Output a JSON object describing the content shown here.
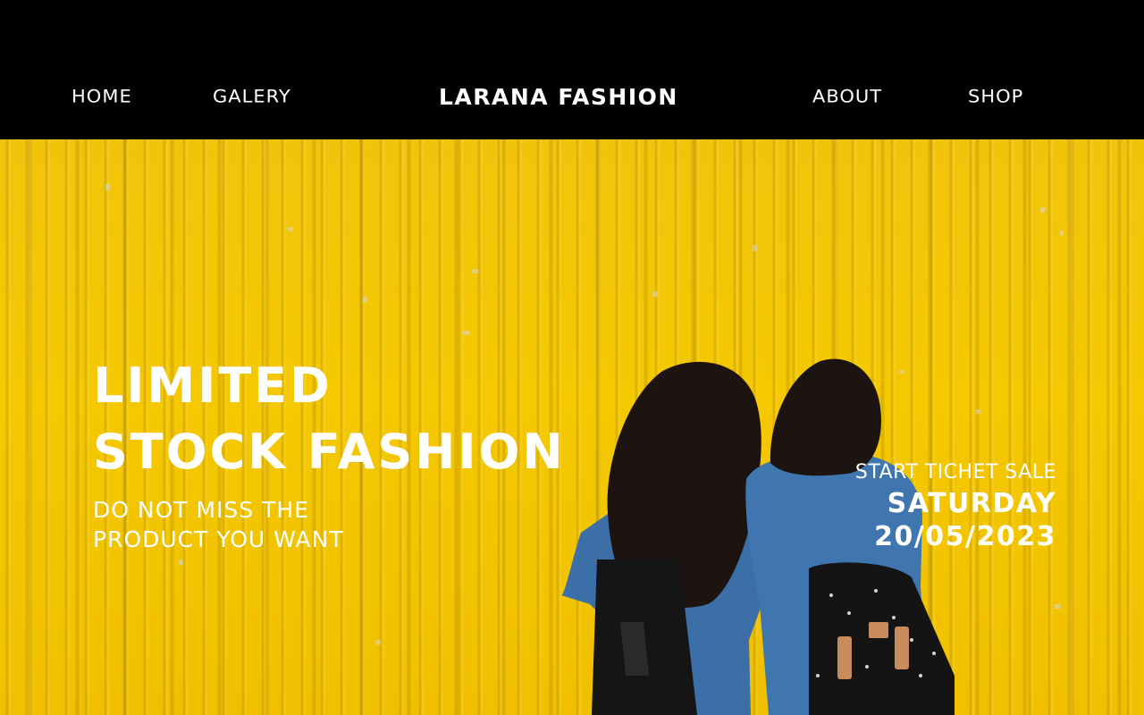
{
  "nav": {
    "home": "HOME",
    "galery": "GALERY",
    "brand": "LARANA FASHION",
    "about": "ABOUT",
    "shop": "SHOP"
  },
  "hero": {
    "headline_line1": "LIMITED",
    "headline_line2": "STOCK FASHION",
    "subtitle_line1": "DO NOT MISS THE",
    "subtitle_line2": "PRODUCT YOU WANT",
    "sale_label": "START TICHET SALE",
    "sale_day": "SATURDAY",
    "sale_date": "20/05/2023"
  },
  "colors": {
    "topbar": "#000000",
    "hero_yellow": "#f5c800",
    "text": "#ffffff"
  }
}
